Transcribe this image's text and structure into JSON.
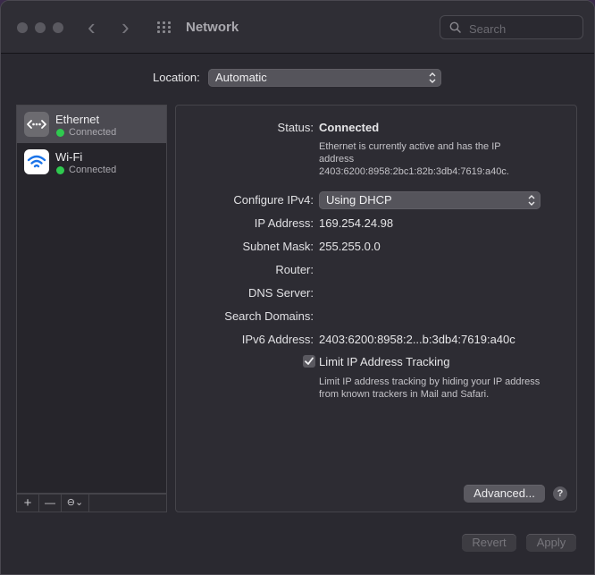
{
  "window": {
    "title": "Network",
    "search_placeholder": "Search",
    "nav_back": "‹",
    "nav_forward": "›"
  },
  "location": {
    "label": "Location:",
    "value": "Automatic"
  },
  "sidebar": {
    "services": [
      {
        "name": "Ethernet",
        "status": "Connected",
        "icon": "ethernet-icon",
        "selected": true
      },
      {
        "name": "Wi-Fi",
        "status": "Connected",
        "icon": "wifi-icon",
        "selected": false
      }
    ],
    "buttons": {
      "add": "+",
      "remove": "—",
      "actions": "⊖⌄"
    }
  },
  "details": {
    "status_label": "Status:",
    "status_value": "Connected",
    "status_desc_1": "Ethernet is currently active and has the IP",
    "status_desc_2": "address",
    "status_desc_3": "2403:6200:8958:2bc1:82b:3db4:7619:a40c.",
    "configure_label": "Configure IPv4:",
    "configure_value": "Using DHCP",
    "ip_label": "IP Address:",
    "ip_value": "169.254.24.98",
    "subnet_label": "Subnet Mask:",
    "subnet_value": "255.255.0.0",
    "router_label": "Router:",
    "dns_label": "DNS Server:",
    "search_domains_label": "Search Domains:",
    "ipv6_label": "IPv6 Address:",
    "ipv6_value": "2403:6200:8958:2...b:3db4:7619:a40c",
    "limit_label": "Limit IP Address Tracking",
    "limit_checked": true,
    "limit_desc_1": "Limit IP address tracking by hiding your IP address",
    "limit_desc_2": "from known trackers in Mail and Safari.",
    "advanced_label": "Advanced...",
    "help_label": "?"
  },
  "footer": {
    "revert_label": "Revert",
    "apply_label": "Apply"
  },
  "colors": {
    "connected_dot": "#2fc94f",
    "wifi_icon_bg": "#ffffff",
    "wifi_icon_fg": "#1a73e8"
  }
}
